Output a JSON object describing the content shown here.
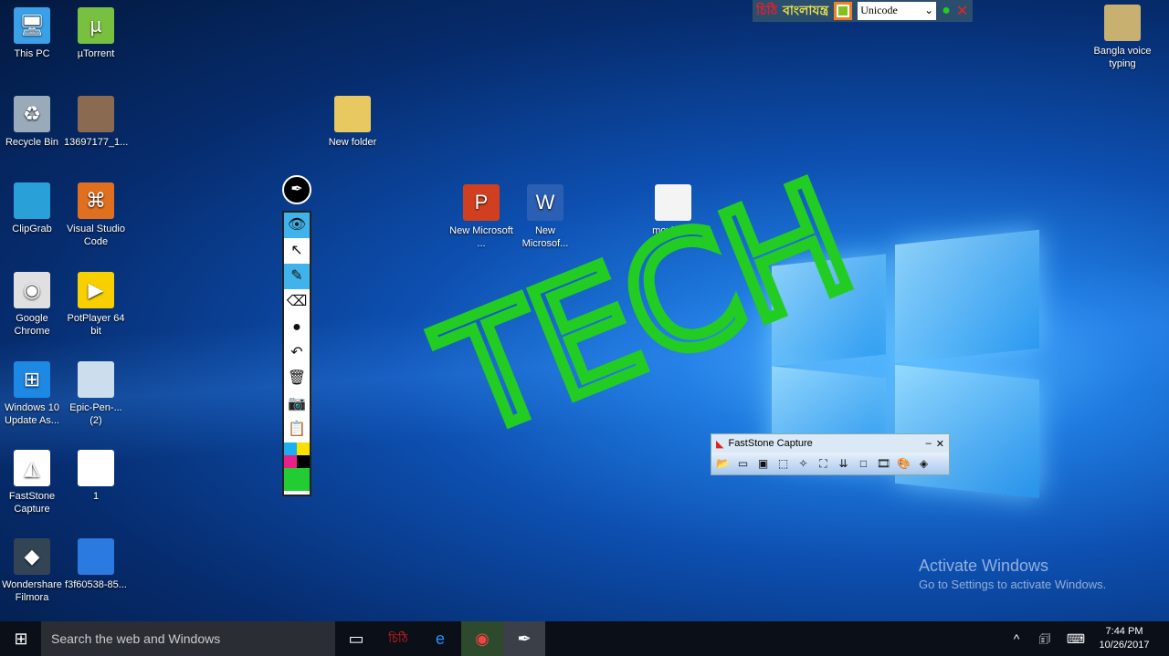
{
  "desktop": {
    "icons": [
      {
        "label": "This PC",
        "color": "#3aa0e8",
        "glyph": "🖥"
      },
      {
        "label": "µTorrent",
        "color": "#78c040",
        "glyph": "µ"
      },
      {
        "label": "Recycle Bin",
        "color": "#9ab",
        "glyph": "♻"
      },
      {
        "label": "13697177_1...",
        "color": "#8a6a50",
        "glyph": ""
      },
      {
        "label": "ClipGrab",
        "color": "#2aa0d8",
        "glyph": ""
      },
      {
        "label": "Visual Studio Code",
        "color": "#e07020",
        "glyph": "⌘"
      },
      {
        "label": "Google Chrome",
        "color": "#e0e0e0",
        "glyph": "◉"
      },
      {
        "label": "PotPlayer 64 bit",
        "color": "#f8d000",
        "glyph": "▶"
      },
      {
        "label": "Windows 10 Update As...",
        "color": "#1e88e5",
        "glyph": "⊞"
      },
      {
        "label": "Epic-Pen-... (2)",
        "color": "#cde",
        "glyph": ""
      },
      {
        "label": "FastStone Capture",
        "color": "#fff",
        "glyph": "◭"
      },
      {
        "label": "1",
        "color": "#fff",
        "glyph": ""
      },
      {
        "label": "Wondershare Filmora",
        "color": "#345",
        "glyph": "◆"
      },
      {
        "label": "f3f60538-85...",
        "color": "#2a7ae0",
        "glyph": ""
      },
      {
        "label": "New folder",
        "color": "#e8c860",
        "glyph": ""
      },
      {
        "label": "New Microsoft ...",
        "color": "#d04020",
        "glyph": "P"
      },
      {
        "label": "New Microsof...",
        "color": "#2b5fb4",
        "glyph": "W"
      },
      {
        "label": "movie list",
        "color": "#f4f4f4",
        "glyph": ""
      },
      {
        "label": "Bangla voice typing",
        "color": "#c8b070",
        "glyph": ""
      }
    ]
  },
  "annotation": {
    "text": "TECH",
    "color": "#22cc22"
  },
  "bangla_bar": {
    "logo": "চিঠি",
    "name": "বাংলাযন্ত্র",
    "encoding": "Unicode"
  },
  "faststone": {
    "title": "FastStone Capture",
    "minimize": "–",
    "close": "✕"
  },
  "activate": {
    "title": "Activate Windows",
    "subtitle": "Go to Settings to activate Windows."
  },
  "taskbar": {
    "search_placeholder": "Search the web and Windows",
    "time": "7:44 PM",
    "date": "10/26/2017"
  }
}
